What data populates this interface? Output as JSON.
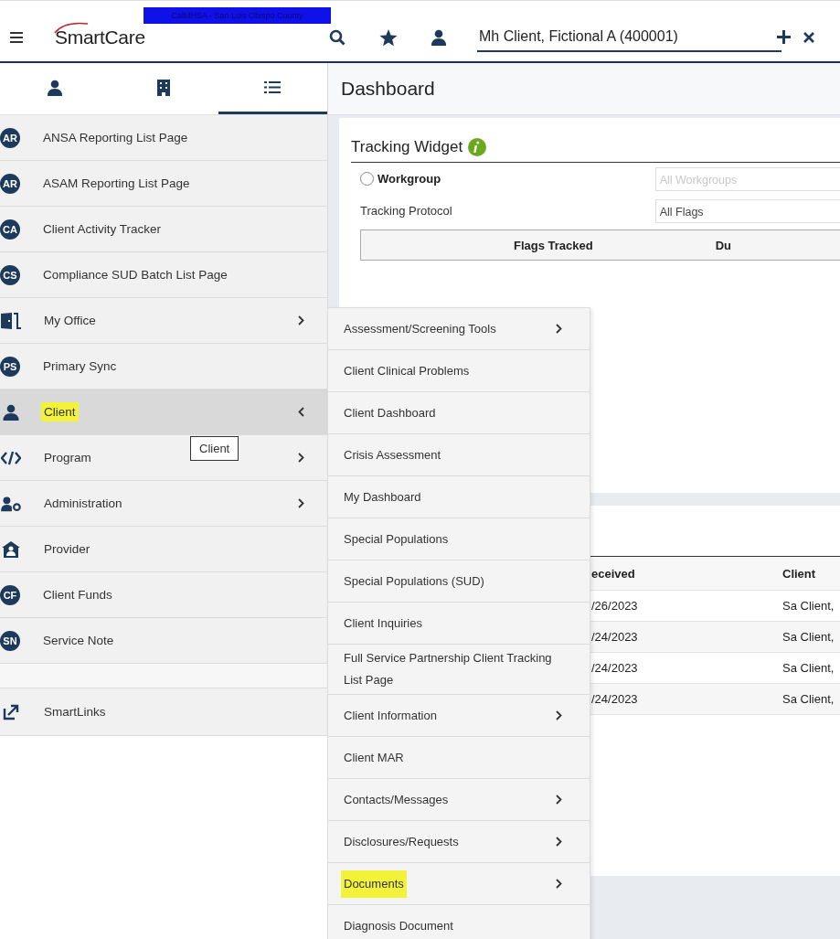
{
  "header": {
    "logo": "SmartCare",
    "banner": "CalMHSA - San Luis Obispo County",
    "client_field": "Mh Client, Fictional A (400001)"
  },
  "sidebar": {
    "tabs": [
      {
        "kind": "person",
        "selected": false
      },
      {
        "kind": "building",
        "selected": false
      },
      {
        "kind": "list",
        "selected": true
      }
    ],
    "items": [
      {
        "label": "ANSA Reporting List Page",
        "kind": "initials",
        "initials": "AR",
        "has_submenu": false,
        "expanded": false,
        "highlighted": false
      },
      {
        "label": "ASAM Reporting List Page",
        "kind": "initials",
        "initials": "AR",
        "has_submenu": false,
        "expanded": false,
        "highlighted": false
      },
      {
        "label": "Client Activity Tracker",
        "kind": "initials",
        "initials": "CA",
        "has_submenu": false,
        "expanded": false,
        "highlighted": false
      },
      {
        "label": "Compliance SUD Batch List Page",
        "kind": "initials",
        "initials": "CS",
        "has_submenu": false,
        "expanded": false,
        "highlighted": false
      },
      {
        "label": "My Office",
        "kind": "office",
        "has_submenu": true,
        "expanded": false,
        "highlighted": false
      },
      {
        "label": "Primary Sync",
        "kind": "initials",
        "initials": "PS",
        "has_submenu": false,
        "expanded": false,
        "highlighted": false
      },
      {
        "label": "Client",
        "kind": "person",
        "has_submenu": true,
        "expanded": true,
        "highlighted": true
      },
      {
        "label": "Program",
        "kind": "code",
        "has_submenu": true,
        "expanded": false,
        "highlighted": false
      },
      {
        "label": "Administration",
        "kind": "admin",
        "has_submenu": true,
        "expanded": false,
        "highlighted": false
      },
      {
        "label": "Provider",
        "kind": "provider",
        "has_submenu": false,
        "expanded": false,
        "highlighted": false
      },
      {
        "label": "Client Funds",
        "kind": "initials",
        "initials": "CF",
        "has_submenu": false,
        "expanded": false,
        "highlighted": false
      },
      {
        "label": "Service Note",
        "kind": "initials",
        "initials": "SN",
        "has_submenu": false,
        "expanded": false,
        "highlighted": false
      }
    ],
    "links": [
      {
        "label": "SmartLinks",
        "kind": "external"
      }
    ],
    "tooltip": "Client"
  },
  "main": {
    "title": "Dashboard",
    "tracking_widget": {
      "title": "Tracking Widget",
      "workgroup": {
        "label": "Workgroup",
        "checked": false,
        "value": "All Workgroups",
        "disabled": true
      },
      "protocol": {
        "label": "Tracking Protocol",
        "value": "All Flags"
      },
      "columns": [
        "Flags Tracked",
        "Du"
      ]
    },
    "table": {
      "columns": [
        "eceived",
        "Client"
      ],
      "rows": [
        [
          "/26/2023",
          "Sa Client,"
        ],
        [
          "/24/2023",
          "Sa Client,"
        ],
        [
          "/24/2023",
          "Sa Client,"
        ],
        [
          "/24/2023",
          "Sa Client,"
        ]
      ]
    }
  },
  "flyout_menu": [
    {
      "label": "Assessment/Screening Tools",
      "has_submenu": true,
      "highlighted": false
    },
    {
      "label": "Client Clinical Problems",
      "has_submenu": false,
      "highlighted": false
    },
    {
      "label": "Client Dashboard",
      "has_submenu": false,
      "highlighted": false
    },
    {
      "label": "Crisis Assessment",
      "has_submenu": false,
      "highlighted": false
    },
    {
      "label": "My Dashboard",
      "has_submenu": false,
      "highlighted": false
    },
    {
      "label": "Special Populations",
      "has_submenu": false,
      "highlighted": false
    },
    {
      "label": "Special Populations (SUD)",
      "has_submenu": false,
      "highlighted": false
    },
    {
      "label": "Client Inquiries",
      "has_submenu": false,
      "highlighted": false
    },
    {
      "label": "Full Service Partnership Client Tracking List Page",
      "has_submenu": false,
      "highlighted": false
    },
    {
      "label": "Client Information",
      "has_submenu": true,
      "highlighted": false
    },
    {
      "label": "Client MAR",
      "has_submenu": false,
      "highlighted": false
    },
    {
      "label": "Contacts/Messages",
      "has_submenu": true,
      "highlighted": false
    },
    {
      "label": "Disclosures/Requests",
      "has_submenu": true,
      "highlighted": false
    },
    {
      "label": "Documents",
      "has_submenu": true,
      "highlighted": true
    },
    {
      "label": "Diagnosis Document",
      "has_submenu": false,
      "highlighted": false
    }
  ]
}
